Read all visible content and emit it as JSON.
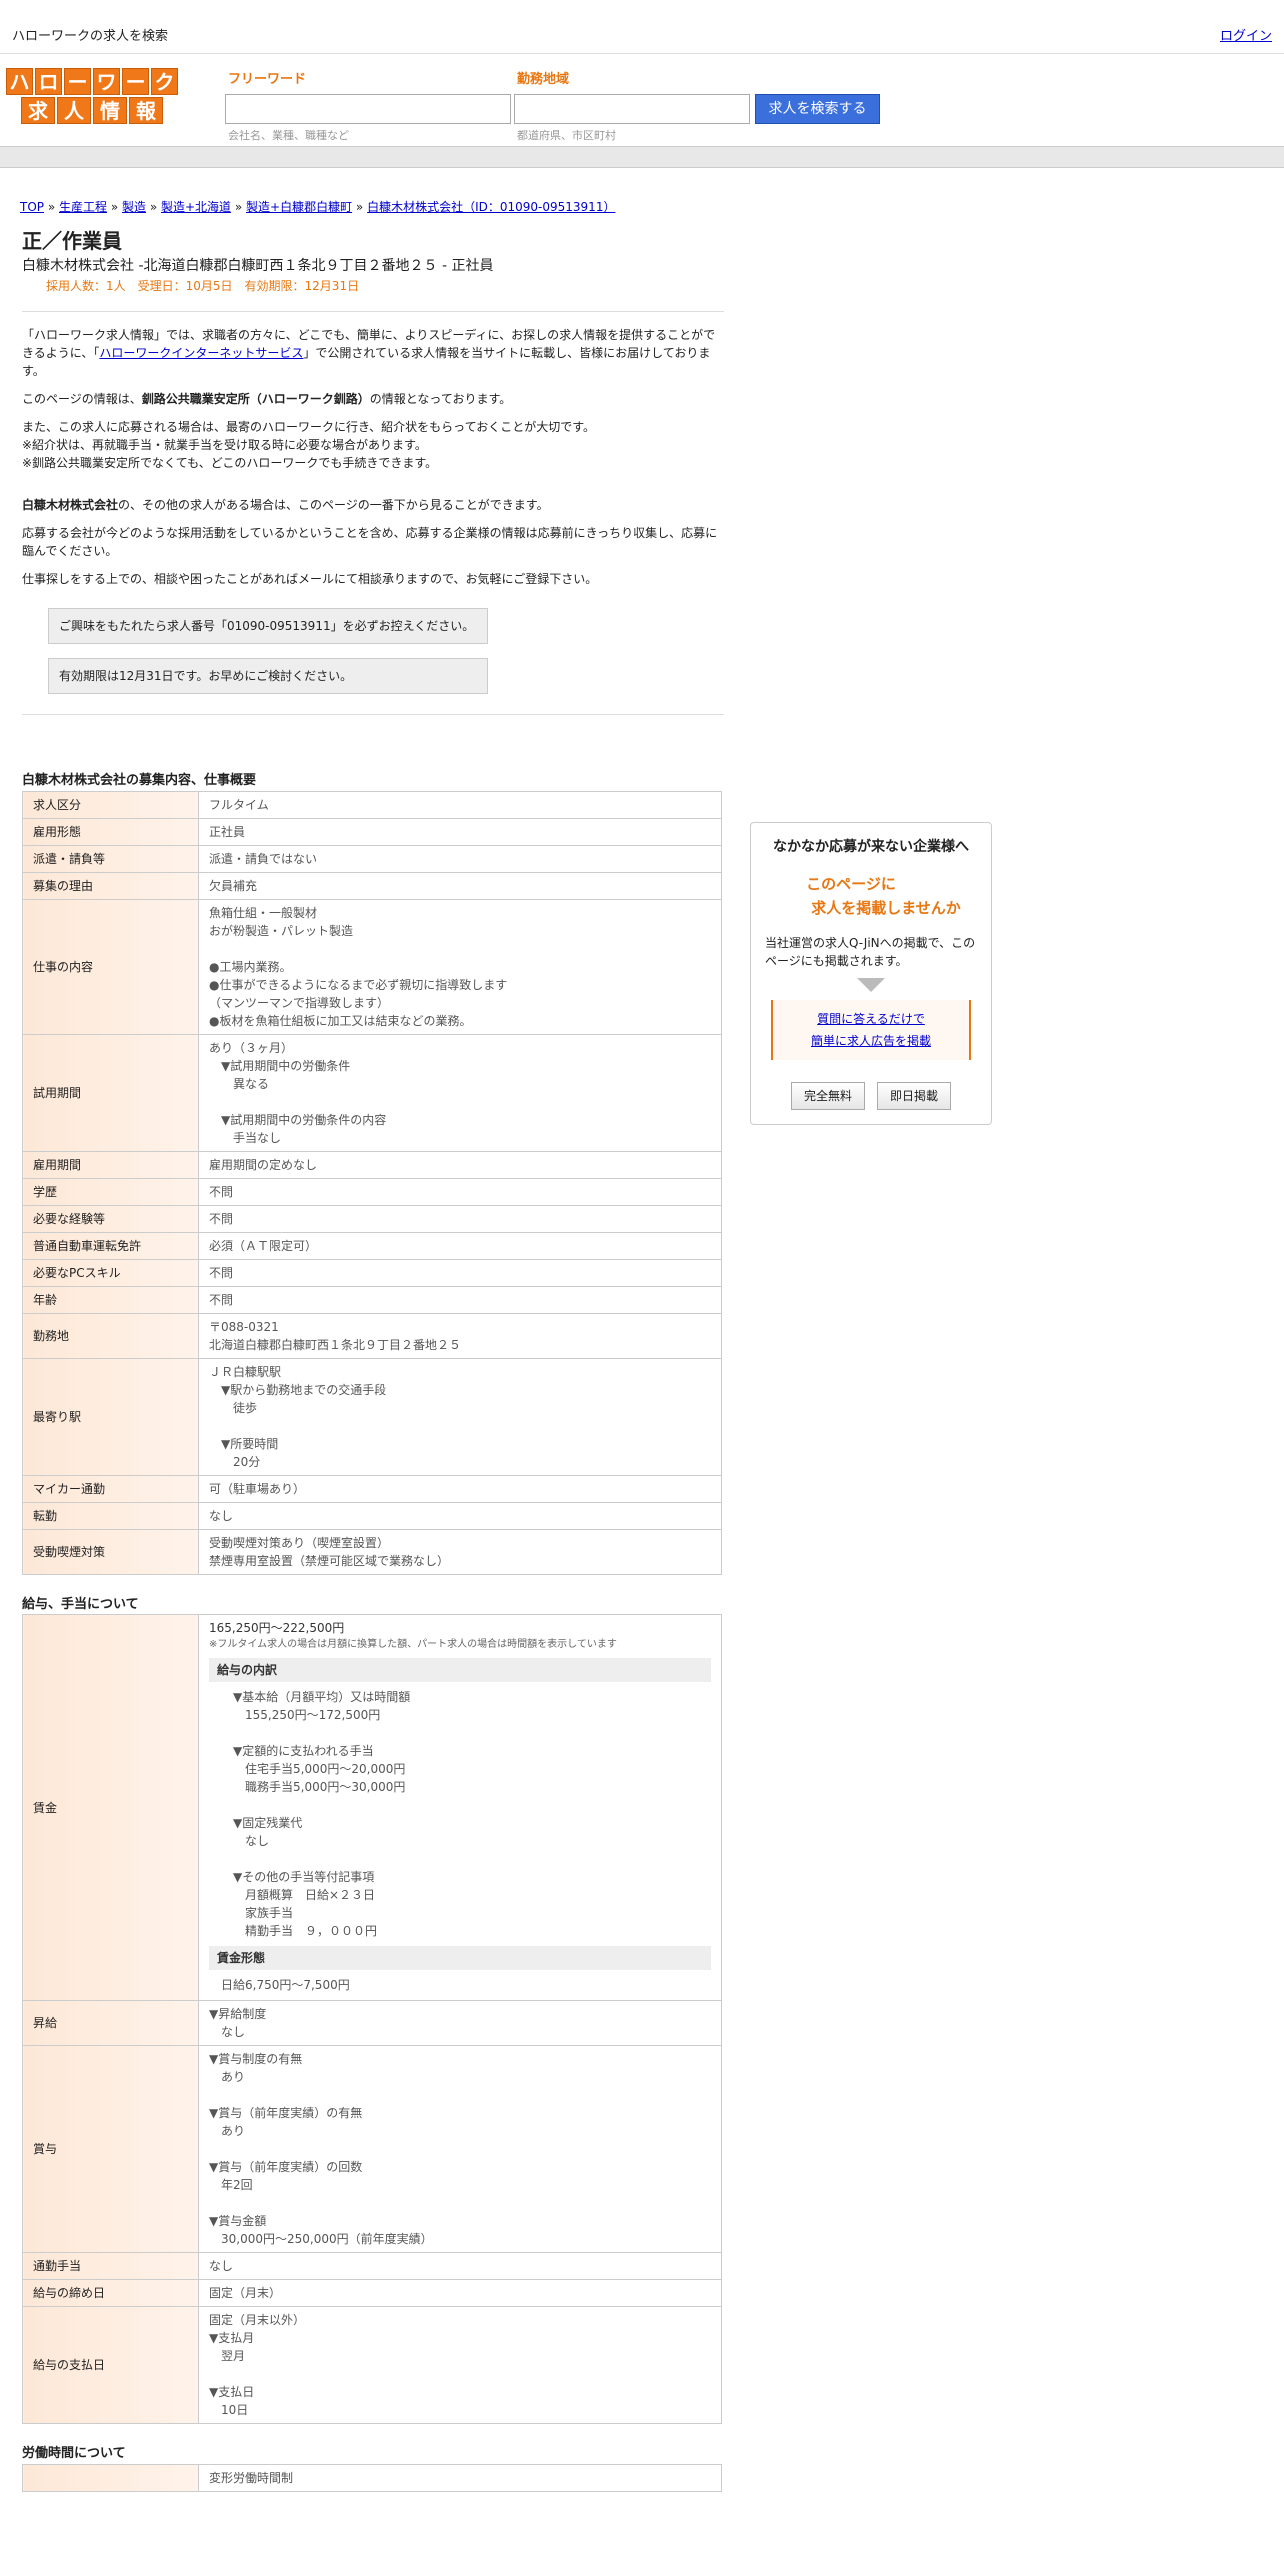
{
  "top": {
    "title": "ハローワークの求人を検索",
    "login": "ログイン"
  },
  "logo": {
    "row1": [
      "ハ",
      "ロ",
      "ー",
      "ワ",
      "ー",
      "ク"
    ],
    "row2": [
      "求",
      "人",
      "情",
      "報"
    ]
  },
  "search": {
    "freeword_label": "フリーワード",
    "freeword_hint": "会社名、業種、職種など",
    "area_label": "勤務地域",
    "area_hint": "都道府県、市区町村",
    "button": "求人を検索する"
  },
  "breadcrumb": [
    "TOP",
    "生産工程",
    "製造",
    "製造+北海道",
    "製造+白糠郡白糠町",
    "白糠木材株式会社（ID：01090-09513911）"
  ],
  "job": {
    "title": "正／作業員",
    "subtitle": "白糠木材株式会社 -北海道白糠郡白糠町西１条北９丁目２番地２５ - 正社員",
    "meta": "採用人数：1人　受理日：10月5日　有効期限：12月31日"
  },
  "intro": {
    "p1a": "「ハローワーク求人情報」では、求職者の方々に、どこでも、簡単に、よりスピーディに、お探しの求人情報を提供することができるように、「",
    "p1link": "ハローワークインターネットサービス",
    "p1b": "」で公開されている求人情報を当サイトに転載し、皆様にお届けしております。",
    "p2a": "このページの情報は、",
    "p2b": "釧路公共職業安定所（ハローワーク釧路）",
    "p2c": "の情報となっております。",
    "p3": "また、この求人に応募される場合は、最寄のハローワークに行き、紹介状をもらっておくことが大切です。\n※紹介状は、再就職手当・就業手当を受け取る時に必要な場合があります。\n※釧路公共職業安定所でなくても、どこのハローワークでも手続きできます。",
    "p4a": "白糠木材株式会社",
    "p4b": "の、その他の求人がある場合は、このページの一番下から見ることができます。",
    "p5": "応募する会社が今どのような採用活動をしているかということを含め、応募する企業様の情報は応募前にきっちり収集し、応募に臨んでください。",
    "p6": "仕事探しをする上での、相談や困ったことがあればメールにて相談承りますので、お気軽にご登録下さい。",
    "n1": "ご興味をもたれたら求人番号「01090-09513911」を必ずお控えください。",
    "n2": "有効期限は12月31日です。お早めにご検討ください。"
  },
  "s1": {
    "heading": "白糠木材株式会社の募集内容、仕事概要",
    "rows": [
      [
        "求人区分",
        "フルタイム"
      ],
      [
        "雇用形態",
        "正社員"
      ],
      [
        "派遣・請負等",
        "派遣・請負ではない"
      ],
      [
        "募集の理由",
        "欠員補充"
      ],
      [
        "仕事の内容",
        "魚箱仕組・一般製材\nおが粉製造・パレット製造\n\n●工場内業務。\n●仕事ができるようになるまで必ず親切に指導致します\n（マンツーマンで指導致します）\n●板材を魚箱仕組板に加工又は結束などの業務。"
      ],
      [
        "試用期間",
        "あり（３ヶ月）\n　▼試用期間中の労働条件\n　　異なる\n\n　▼試用期間中の労働条件の内容\n　　手当なし"
      ],
      [
        "雇用期間",
        "雇用期間の定めなし"
      ],
      [
        "学歴",
        "不問"
      ],
      [
        "必要な経験等",
        "不問"
      ],
      [
        "普通自動車運転免許",
        "必須（ＡＴ限定可）"
      ],
      [
        "必要なPCスキル",
        "不問"
      ],
      [
        "年齢",
        "不問"
      ],
      [
        "勤務地",
        "〒088-0321\n北海道白糠郡白糠町西１条北９丁目２番地２５"
      ],
      [
        "最寄り駅",
        "ＪＲ白糠駅駅\n　▼駅から勤務地までの交通手段\n　　徒歩\n\n　▼所要時間\n　　20分"
      ],
      [
        "マイカー通勤",
        "可（駐車場あり）"
      ],
      [
        "転勤",
        "なし"
      ],
      [
        "受動喫煙対策",
        "受動喫煙対策あり（喫煙室設置）\n禁煙専用室設置（禁煙可能区域で業務なし）"
      ]
    ]
  },
  "s2": {
    "heading": "給与、手当について",
    "wage_label": "賃金",
    "wage_range": "165,250円〜222,500円",
    "wage_note": "※フルタイム求人の場合は月額に換算した額、パート求人の場合は時間額を表示しています",
    "breakdown_h": "給与の内訳",
    "breakdown": "　　▼基本給（月額平均）又は時間額\n　　　155,250円〜172,500円\n\n　　▼定額的に支払われる手当\n　　　住宅手当5,000円〜20,000円\n　　　職務手当5,000円〜30,000円\n\n　　▼固定残業代\n　　　なし\n\n　　▼その他の手当等付記事項\n　　　月額概算　日給×２３日\n　　　家族手当\n　　　精勤手当　９，０００円",
    "form_h": "賃金形態",
    "form": "　日給6,750円〜7,500円",
    "rows": [
      [
        "昇給",
        "▼昇給制度\n　なし"
      ],
      [
        "賞与",
        "▼賞与制度の有無\n　あり\n\n▼賞与（前年度実績）の有無\n　あり\n\n▼賞与（前年度実績）の回数\n　年2回\n\n▼賞与金額\n　30,000円〜250,000円（前年度実績）"
      ],
      [
        "通勤手当",
        "なし"
      ],
      [
        "給与の締め日",
        "固定（月末）"
      ],
      [
        "給与の支払日",
        "固定（月末以外）\n▼支払月\n　翌月\n\n▼支払日\n　10日"
      ]
    ]
  },
  "s3": {
    "heading": "労働時間について",
    "row": [
      "",
      "変形労働時間制"
    ]
  },
  "side": {
    "t1": "なかなか応募が来ない企業様へ",
    "t2a": "このページに",
    "t2b": "求人を掲載しませんか",
    "t3": "当社運営の求人Q-JiNへの掲載で、このページにも掲載されます。",
    "link1": "質問に答えるだけで",
    "link2": "簡単に求人広告を掲載",
    "btn1": "完全無料",
    "btn2": "即日掲載"
  }
}
